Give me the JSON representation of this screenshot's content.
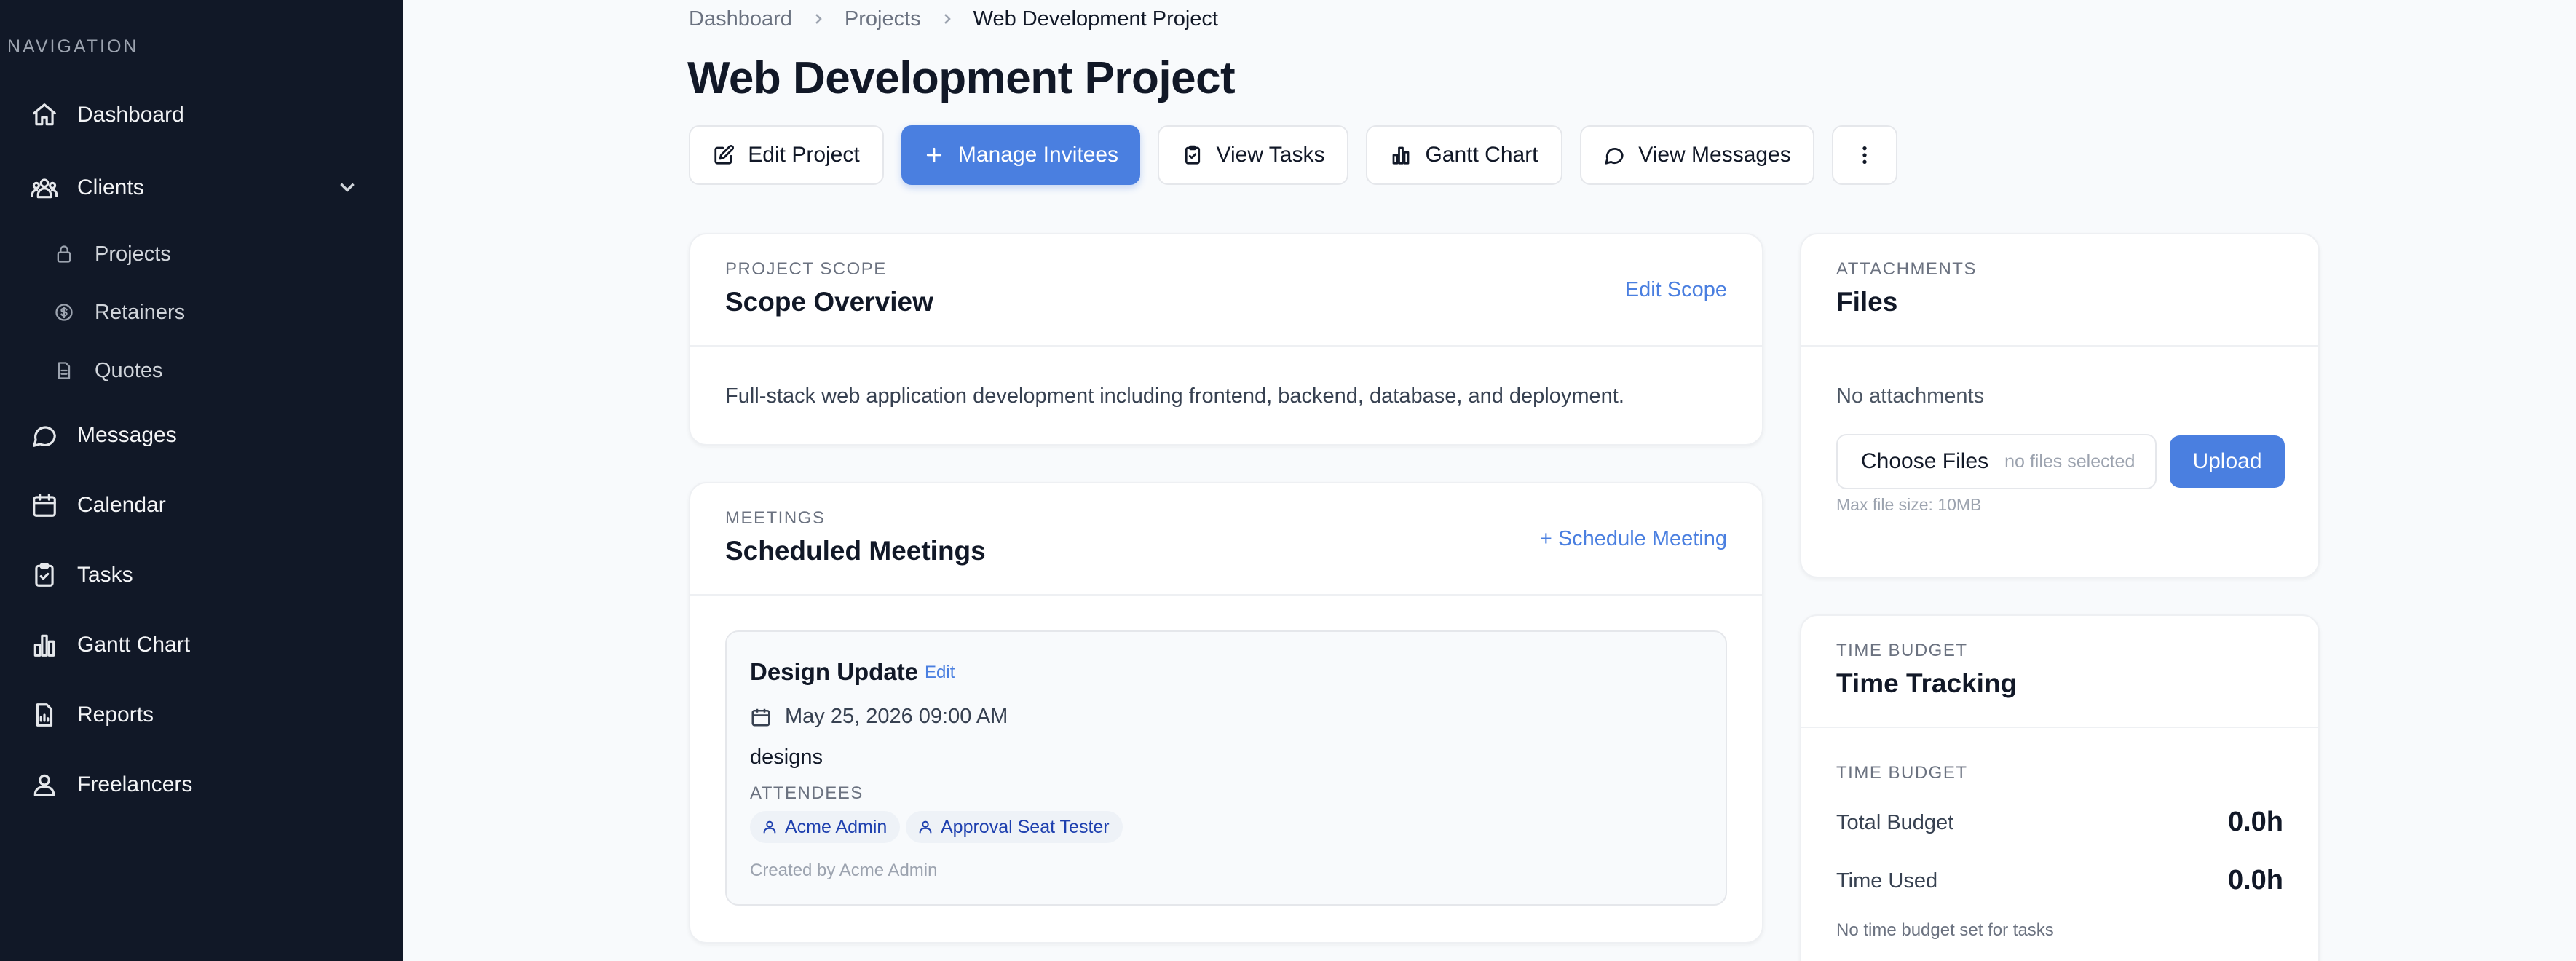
{
  "sidebar": {
    "heading": "NAVIGATION",
    "items": [
      {
        "label": "Dashboard",
        "icon": "home-icon"
      },
      {
        "label": "Clients",
        "icon": "users-icon",
        "expanded": true
      },
      {
        "label": "Messages",
        "icon": "message-icon"
      },
      {
        "label": "Calendar",
        "icon": "calendar-icon"
      },
      {
        "label": "Tasks",
        "icon": "clipboard-check-icon"
      },
      {
        "label": "Gantt Chart",
        "icon": "bar-chart-icon"
      },
      {
        "label": "Reports",
        "icon": "report-icon"
      },
      {
        "label": "Freelancers",
        "icon": "user-group-icon"
      }
    ],
    "sub_items": [
      {
        "label": "Projects",
        "icon": "lock-icon"
      },
      {
        "label": "Retainers",
        "icon": "dollar-circle-icon"
      },
      {
        "label": "Quotes",
        "icon": "document-icon"
      }
    ]
  },
  "breadcrumb": {
    "items": [
      "Dashboard",
      "Projects"
    ],
    "current": "Web Development Project"
  },
  "page": {
    "title": "Web Development Project"
  },
  "toolbar": {
    "edit_project": "Edit Project",
    "manage_invitees": "Manage Invitees",
    "view_tasks": "View Tasks",
    "gantt_chart": "Gantt Chart",
    "view_messages": "View Messages"
  },
  "scope": {
    "eyebrow": "PROJECT SCOPE",
    "title": "Scope Overview",
    "action": "Edit Scope",
    "description": "Full-stack web application development including frontend, backend, database, and deployment."
  },
  "meetings": {
    "eyebrow": "MEETINGS",
    "title": "Scheduled Meetings",
    "action": "+ Schedule Meeting",
    "items": [
      {
        "title": "Design Update",
        "edit": "Edit",
        "datetime": "May 25, 2026 09:00 AM",
        "note": "designs",
        "attendees_label": "ATTENDEES",
        "attendees": [
          "Acme Admin",
          "Approval Seat Tester"
        ],
        "created_by": "Created by Acme Admin"
      }
    ]
  },
  "attachments": {
    "eyebrow": "ATTACHMENTS",
    "title": "Files",
    "empty": "No attachments",
    "choose_files": "Choose Files",
    "no_files": "no files selected",
    "upload": "Upload",
    "hint": "Max file size: 10MB"
  },
  "time": {
    "eyebrow": "TIME BUDGET",
    "title": "Time Tracking",
    "section_label": "TIME BUDGET",
    "total_label": "Total Budget",
    "total_value": "0.0h",
    "used_label": "Time Used",
    "used_value": "0.0h",
    "note": "No time budget set for tasks"
  },
  "colors": {
    "sidebar_bg": "#111827",
    "accent": "#4a7fe0",
    "page_bg": "#f8fafc"
  }
}
